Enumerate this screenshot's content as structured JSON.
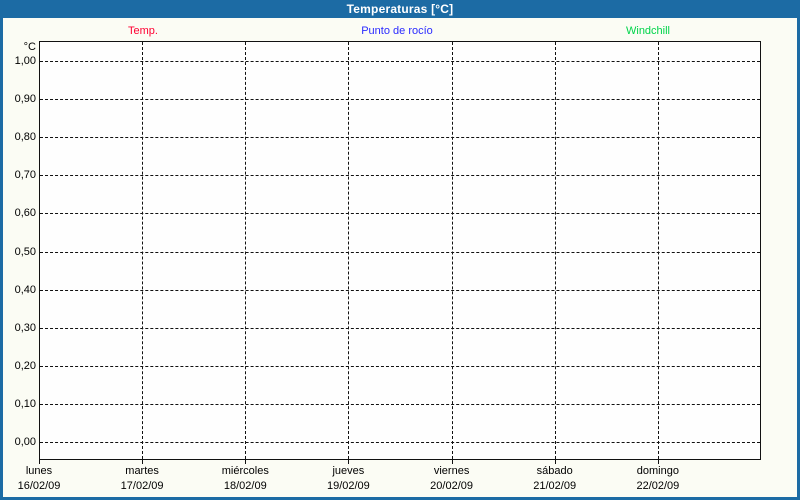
{
  "colors": {
    "frame": "#1c6ba4",
    "titlebar_bg": "#1c6ba4",
    "titlebar_text": "#ffffff",
    "page_bg": "#fbfcf4",
    "plot_bg": "#fefefe",
    "grid": "#111111",
    "temp_red": "#ff0033",
    "dew_blue": "#2a2aff",
    "windchill_green": "#00d44a"
  },
  "chart_data": {
    "type": "line",
    "title": "Temperaturas [°C]",
    "ylabel_unit": "°C",
    "ylim": [
      0.0,
      1.0
    ],
    "ytick_step": 0.1,
    "ytick_labels_top_to_bottom": [
      "1,00",
      "0,90",
      "0,80",
      "0,70",
      "0,60",
      "0,50",
      "0,40",
      "0,30",
      "0,20",
      "0,10",
      "0,00"
    ],
    "grid": "dashed",
    "legend_position": "top",
    "x_axis": {
      "days": [
        {
          "name": "lunes",
          "date": "16/02/09"
        },
        {
          "name": "martes",
          "date": "17/02/09"
        },
        {
          "name": "miércoles",
          "date": "18/02/09"
        },
        {
          "name": "jueves",
          "date": "19/02/09"
        },
        {
          "name": "viernes",
          "date": "20/02/09"
        },
        {
          "name": "sábado",
          "date": "21/02/09"
        },
        {
          "name": "domingo",
          "date": "22/02/09"
        }
      ]
    },
    "series": [
      {
        "name": "Temp.",
        "color": "#ff0033",
        "values": []
      },
      {
        "name": "Punto de rocío",
        "color": "#2a2aff",
        "values": []
      },
      {
        "name": "Windchill",
        "color": "#00d44a",
        "values": []
      }
    ]
  }
}
